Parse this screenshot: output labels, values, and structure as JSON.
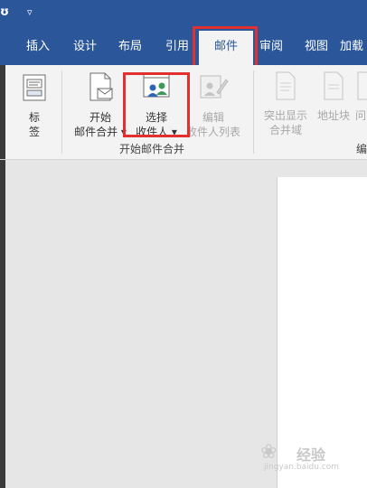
{
  "titlebar": {
    "save_glyph": "ʊ",
    "qat_arrow": "▿"
  },
  "tabs": [
    {
      "label": "插入"
    },
    {
      "label": "设计"
    },
    {
      "label": "布局"
    },
    {
      "label": "引用"
    },
    {
      "label": "邮件",
      "active": true
    },
    {
      "label": "审阅"
    },
    {
      "label": "视图"
    },
    {
      "label": "加载"
    }
  ],
  "ribbon": {
    "labels_button": {
      "line1": "标",
      "line2": "签"
    },
    "start_mail_merge": {
      "line1": "开始",
      "line2": "邮件合并 ▾"
    },
    "select_recipients": {
      "line1": "选择",
      "line2": "收件人 ▾"
    },
    "edit_recipients": {
      "line1": "编辑",
      "line2": "收件人列表"
    },
    "highlight_merge_fields": {
      "line1": "突出显示",
      "line2": "合并域"
    },
    "address_block": {
      "line1": "地址块"
    },
    "greeting_partial": {
      "line1": "问"
    },
    "group_start_mail_merge": "开始邮件合并",
    "group_write_partial": "编"
  },
  "watermark": {
    "big_text": "经验",
    "small_text": "jingyan.baidu.com"
  },
  "colors": {
    "accent": "#2b579a",
    "highlight_box": "#e03030",
    "ribbon_bg": "#f3f3f3",
    "disabled_text": "#a8a8a8"
  }
}
